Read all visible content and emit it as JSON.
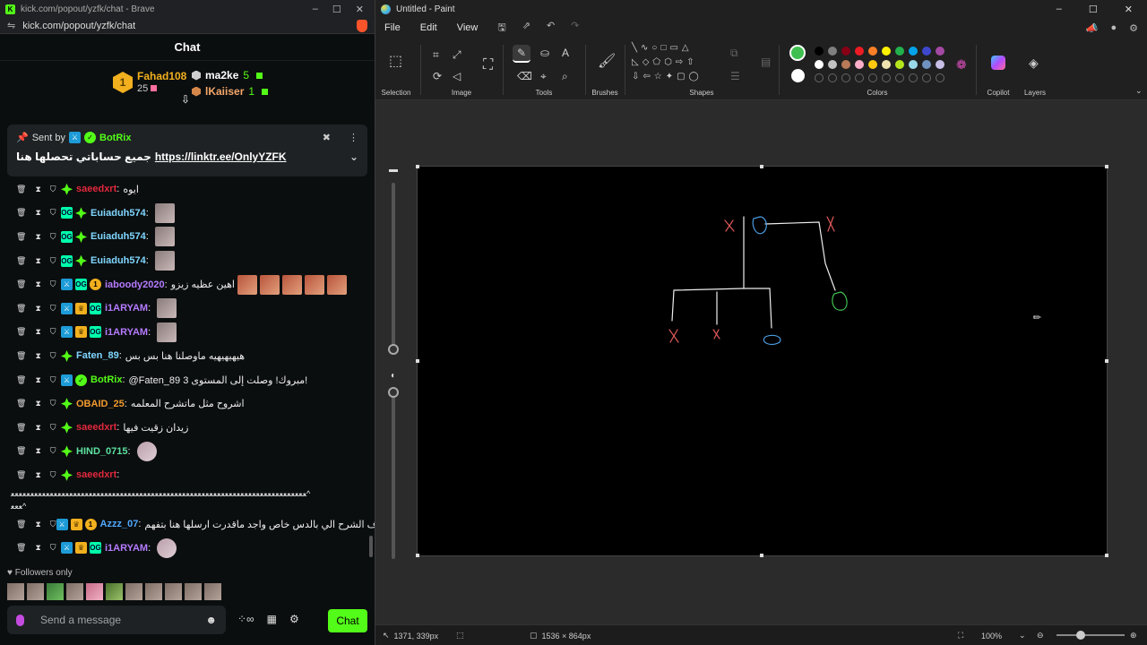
{
  "brave": {
    "window_title": "kick.com/popout/yzfk/chat - Brave",
    "address": "kick.com/popout/yzfk/chat",
    "chat_header": "Chat",
    "leaderboard": [
      {
        "rank": "1",
        "name": "Fahad108",
        "count": "25"
      },
      {
        "name": "ma2ke",
        "count": "5"
      },
      {
        "name": "lKaiiser",
        "count": "1"
      }
    ],
    "pinned": {
      "sent_by_label": "Sent by",
      "sender": "BotRix",
      "message_ar": "جميع حساباتي تحصلها هنا",
      "link": "https://linktr.ee/OnlyYZFK"
    },
    "messages": [
      {
        "user": "saeedxrt",
        "color": "#e0283c",
        "text": "ايوه",
        "emotes": 0
      },
      {
        "user": "Euiaduh574",
        "color": "#7fd6ff",
        "text": "",
        "emotes": 1
      },
      {
        "user": "Euiaduh574",
        "color": "#7fd6ff",
        "text": "",
        "emotes": 1
      },
      {
        "user": "Euiaduh574",
        "color": "#7fd6ff",
        "text": "",
        "emotes": 1
      },
      {
        "user": "iaboody2020",
        "color": "#b57bff",
        "text": "اهين عظيه زيزو",
        "emotes": 5
      },
      {
        "user": "i1ARYAM",
        "color": "#b57bff",
        "text": "",
        "emotes": 1
      },
      {
        "user": "i1ARYAM",
        "color": "#b57bff",
        "text": "",
        "emotes": 1
      },
      {
        "user": "Faten_89",
        "color": "#7fd6ff",
        "text": "هيهيهيهيه ماوصلنا هنا بس بس",
        "emotes": 0
      },
      {
        "user": "BotRix",
        "color": "#53fc18",
        "text": "@Faten_89 مبروك! وصلت إلى المستوى 3!",
        "emotes": 0
      },
      {
        "user": "OBAID_25",
        "color": "#f29a2e",
        "text": "اشروح مثل ماتشرح المعلمه",
        "emotes": 0
      },
      {
        "user": "saeedxrt",
        "color": "#e0283c",
        "text": "زيدان زقيت فيها",
        "emotes": 0
      },
      {
        "user": "HIND_0715",
        "color": "#5ce1a0",
        "text": "",
        "emotes": 1
      },
      {
        "user": "saeedxrt",
        "color": "#e0283c",
        "text": "",
        "emotes": 0
      },
      {
        "user": "Azzz_07",
        "color": "#4fa8ff",
        "text": "شوف الشرح الي بالدس خاص واجد ماقدرت ارسلها هنا بتفهم",
        "emotes": 0
      },
      {
        "user": "i1ARYAM",
        "color": "#b57bff",
        "text": "",
        "emotes": 1
      }
    ],
    "wrap_text_1": "ﻌﻌﻌﻌﻌﻌﻌﻌﻌﻌﻌﻌﻌﻌﻌﻌﻌﻌﻌﻌﻌﻌﻌﻌﻌﻌﻌﻌﻌﻌﻌﻌﻌﻌﻌﻌﻌﻌﻌﻌﻌﻌﻌﻌﻌﻌﻌﻌﻌﻌﻌﻌﻌﻌﻌﻌﻌﻌﻌﻌﻌﻌﻌﻌﻌﻌﻌﻌﻌﻌﻌﻌﻌﻌﻌﻌ^",
    "wrap_text_2": "ﻌﻌﻌ^",
    "followers_only": "Followers only",
    "input_placeholder": "Send a message",
    "chat_button": "Chat"
  },
  "paint": {
    "window_title": "Untitled - Paint",
    "menus": [
      "File",
      "Edit",
      "View"
    ],
    "groups": {
      "selection": "Selection",
      "image": "Image",
      "tools": "Tools",
      "brushes": "Brushes",
      "shapes": "Shapes",
      "colors": "Colors",
      "copilot": "Copilot",
      "layers": "Layers"
    },
    "palette_row1": [
      "#000000",
      "#7f7f7f",
      "#880015",
      "#ed1c24",
      "#ff7f27",
      "#fff200",
      "#22b14c",
      "#00a2e8",
      "#3f48cc",
      "#a349a4"
    ],
    "palette_row2": [
      "#ffffff",
      "#c3c3c3",
      "#b97a57",
      "#ffaec9",
      "#ffc90e",
      "#efe4b0",
      "#b5e61d",
      "#99d9ea",
      "#7092be",
      "#c8bfe7"
    ],
    "primary_color": "#3fbf4f",
    "secondary_color": "#ffffff",
    "status": {
      "cursor_pos": "1371, 339px",
      "canvas_size": "1536 × 864px",
      "zoom": "100%"
    }
  }
}
